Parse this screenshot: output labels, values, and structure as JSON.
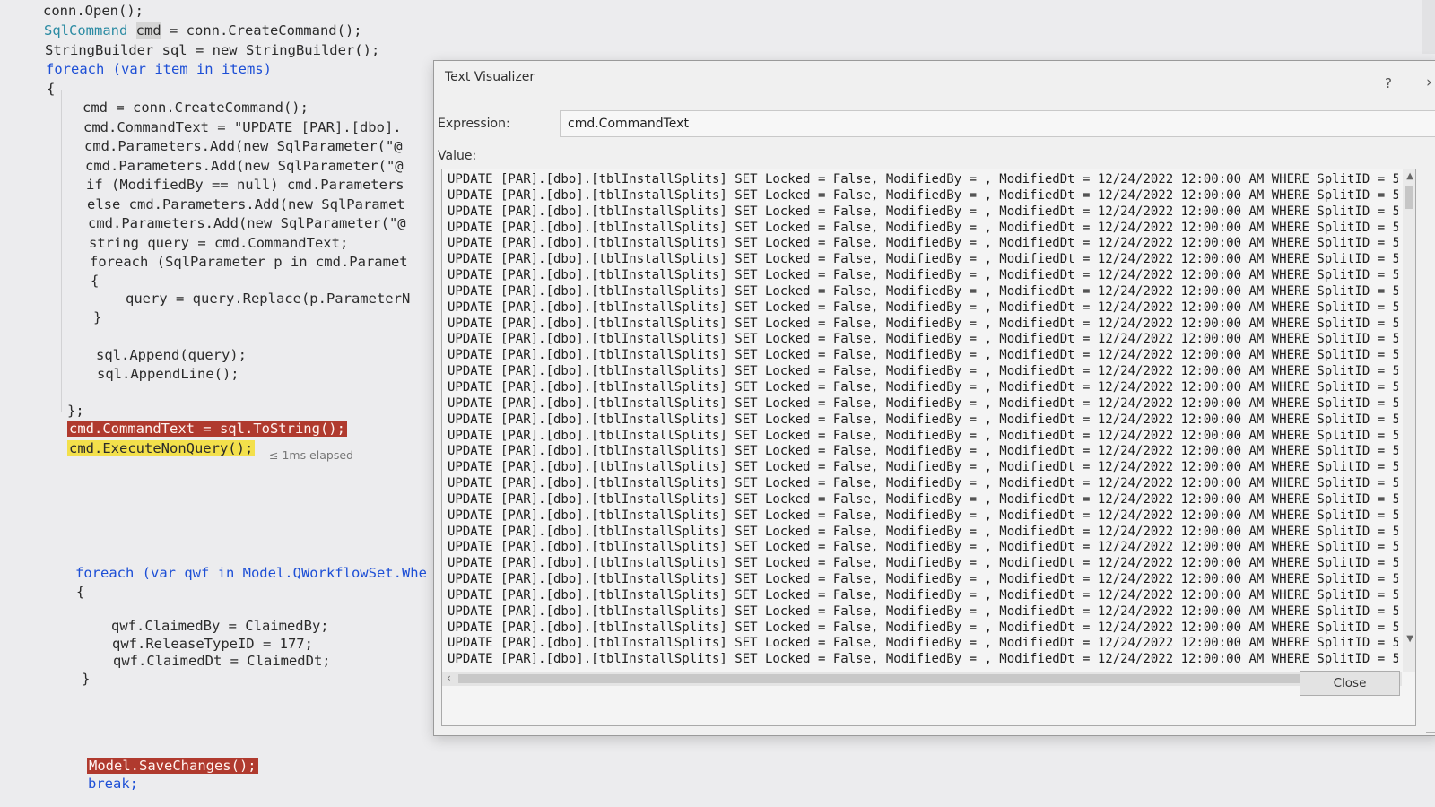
{
  "code": {
    "l1": "conn.Open();",
    "l2_a": "SqlCommand ",
    "l2_b": "cmd",
    "l2_c": " = conn.CreateCommand();",
    "l3": "StringBuilder sql = new StringBuilder();",
    "l4": "foreach (var item in items)",
    "l5": "{",
    "l6": "cmd = conn.CreateCommand();",
    "l7": "cmd.CommandText = \"UPDATE [PAR].[dbo].",
    "l8": "cmd.Parameters.Add(new SqlParameter(\"@",
    "l9": "cmd.Parameters.Add(new SqlParameter(\"@",
    "l10": "if (ModifiedBy == null) cmd.Parameters",
    "l11": "else cmd.Parameters.Add(new SqlParamet",
    "l12": "cmd.Parameters.Add(new SqlParameter(\"@",
    "l13": "string query = cmd.CommandText;",
    "l14": "foreach (SqlParameter p in cmd.Paramet",
    "l15": "{",
    "l16": "query = query.Replace(p.ParameterN",
    "l17": "}",
    "l18": "sql.Append(query);",
    "l19": "sql.AppendLine();",
    "l20": "};",
    "l21": "cmd.CommandText = sql.ToString();",
    "l22": "cmd.ExecuteNonQuery();",
    "elapsed": "≤ 1ms elapsed",
    "l23": "foreach (var qwf in Model.QWorkflowSet.Whe",
    "l24": "{",
    "l25": "qwf.ClaimedBy = ClaimedBy;",
    "l26": "qwf.ReleaseTypeID = 177;",
    "l27": "qwf.ClaimedDt = ClaimedDt;",
    "l28": "}",
    "l29": "Model.SaveChanges();",
    "l30": "break;"
  },
  "dialog": {
    "title": "Text Visualizer",
    "help": "?",
    "close_glyph": "›",
    "expression_label": "Expression:",
    "expression_value": "cmd.CommandText",
    "value_label": "Value:",
    "value_line": "UPDATE [PAR].[dbo].[tblInstallSplits] SET Locked = False, ModifiedBy = , ModifiedDt = 12/24/2022 12:00:00 AM WHERE SplitID = 5",
    "value_line_count": 31,
    "close_label": "Close"
  },
  "icons": {
    "up": "chevron-up-icon",
    "down": "chevron-down-icon",
    "left": "chevron-left-icon",
    "right": "chevron-right-icon"
  }
}
